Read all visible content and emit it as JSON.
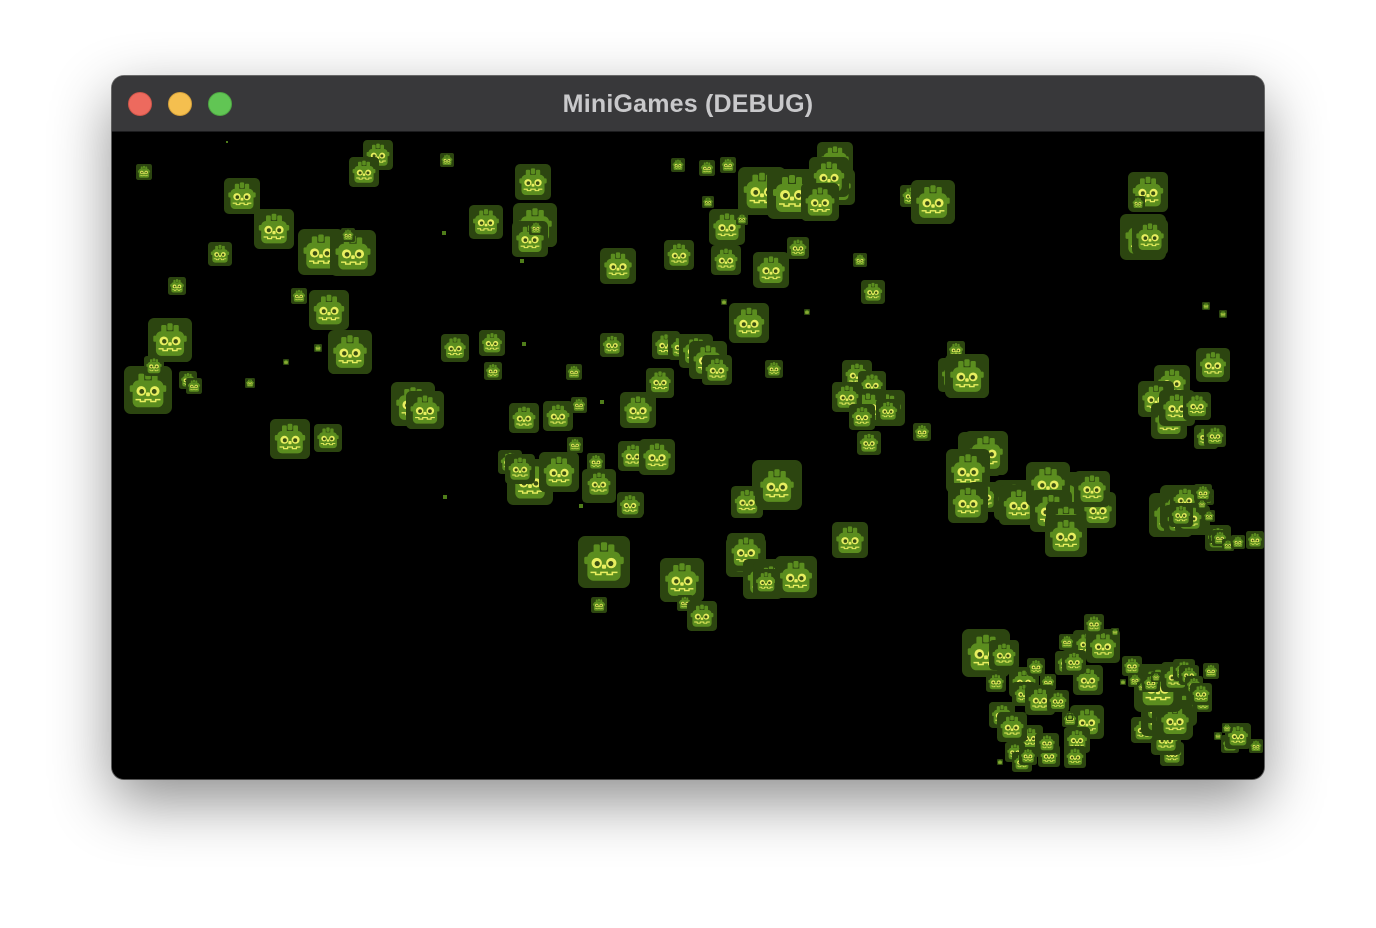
{
  "window": {
    "title": "MiniGames (DEBUG)"
  },
  "controls": {
    "close_color": "#ed6a5e",
    "minimize_color": "#f5bf4f",
    "maximize_color": "#61c554"
  },
  "game": {
    "background": "#000000",
    "sprite_icon": "godot-robot-icon",
    "sprite_colors": {
      "tile": "#2e4a0e",
      "face": "#5a8c1e",
      "eyes": "#e8f060"
    }
  }
}
